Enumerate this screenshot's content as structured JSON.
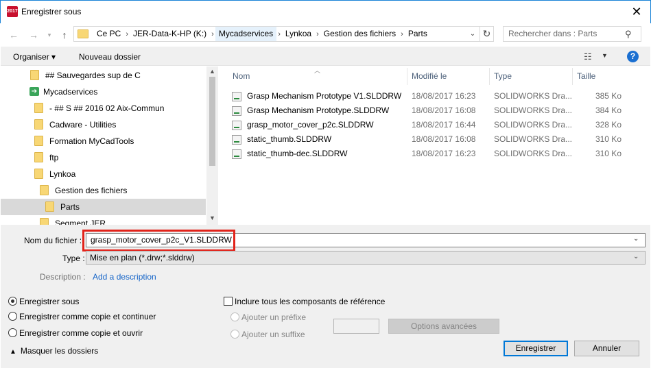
{
  "window": {
    "title": "Enregistrer sous",
    "app_icon_text": "2017",
    "close_glyph": "✕"
  },
  "address": {
    "crumbs": [
      "Ce PC",
      "JER-Data-K-HP (K:)",
      "Mycadservices",
      "Lynkoa",
      "Gestion des fichiers",
      "Parts"
    ],
    "search_placeholder": "Rechercher dans : Parts"
  },
  "toolbar": {
    "organiser": "Organiser ▾",
    "new_folder": "Nouveau dossier"
  },
  "nav": {
    "items": [
      {
        "label": "## Sauvegardes sup de C",
        "icon": "folder-icon"
      },
      {
        "label": "Mycadservices",
        "icon": "shortcut-icon"
      },
      {
        "label": "- ## S ## 2016 02 Aix-Commun",
        "icon": "folder-icon"
      },
      {
        "label": "Cadware - Utilities",
        "icon": "folder-icon"
      },
      {
        "label": "Formation MyCadTools",
        "icon": "folder-icon"
      },
      {
        "label": "ftp",
        "icon": "folder-icon"
      },
      {
        "label": "Lynkoa",
        "icon": "folder-icon"
      },
      {
        "label": "Gestion des fichiers",
        "icon": "folder-icon"
      },
      {
        "label": "Parts",
        "icon": "folder-icon"
      },
      {
        "label": "Segment JER",
        "icon": "folder-icon"
      }
    ]
  },
  "files": {
    "columns": {
      "name": "Nom",
      "date": "Modifié le",
      "type": "Type",
      "size": "Taille"
    },
    "rows": [
      {
        "name": "Grasp Mechanism Prototype V1.SLDDRW",
        "date": "18/08/2017 16:23",
        "type": "SOLIDWORKS Dra...",
        "size": "385 Ko"
      },
      {
        "name": "Grasp Mechanism Prototype.SLDDRW",
        "date": "18/08/2017 16:08",
        "type": "SOLIDWORKS Dra...",
        "size": "384 Ko"
      },
      {
        "name": "grasp_motor_cover_p2c.SLDDRW",
        "date": "18/08/2017 16:44",
        "type": "SOLIDWORKS Dra...",
        "size": "328 Ko"
      },
      {
        "name": "static_thumb.SLDDRW",
        "date": "18/08/2017 16:08",
        "type": "SOLIDWORKS Dra...",
        "size": "310 Ko"
      },
      {
        "name": "static_thumb-dec.SLDDRW",
        "date": "18/08/2017 16:23",
        "type": "SOLIDWORKS Dra...",
        "size": "310 Ko"
      }
    ]
  },
  "form": {
    "filename_label": "Nom du fichier :",
    "filename_value": "grasp_motor_cover_p2c_V1.SLDDRW",
    "type_label": "Type :",
    "type_value": "Mise en plan (*.drw;*.slddrw)",
    "description_label": "Description :",
    "description_link": "Add a description"
  },
  "options": {
    "save_as": "Enregistrer sous",
    "save_copy_continue": "Enregistrer comme copie et continuer",
    "save_copy_open": "Enregistrer comme copie et ouvrir",
    "include_refs": "Inclure tous les composants de référence",
    "add_prefix": "Ajouter un préfixe",
    "add_suffix": "Ajouter un suffixe",
    "advanced": "Options avancées"
  },
  "buttons": {
    "save": "Enregistrer",
    "cancel": "Annuler",
    "hide_folders": "Masquer les dossiers"
  },
  "colors": {
    "accent": "#0078d7",
    "highlight": "#e2231a"
  }
}
